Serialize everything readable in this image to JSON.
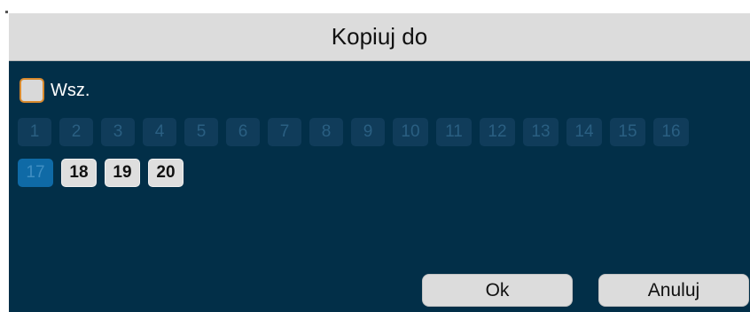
{
  "dialog": {
    "title": "Kopiuj do",
    "select_all_label": "Wsz.",
    "select_all_checked": false,
    "channels_row1": [
      {
        "label": "1",
        "state": "disabled"
      },
      {
        "label": "2",
        "state": "disabled"
      },
      {
        "label": "3",
        "state": "disabled"
      },
      {
        "label": "4",
        "state": "disabled"
      },
      {
        "label": "5",
        "state": "disabled"
      },
      {
        "label": "6",
        "state": "disabled"
      },
      {
        "label": "7",
        "state": "disabled"
      },
      {
        "label": "8",
        "state": "disabled"
      },
      {
        "label": "9",
        "state": "disabled"
      },
      {
        "label": "10",
        "state": "disabled"
      },
      {
        "label": "11",
        "state": "disabled"
      },
      {
        "label": "12",
        "state": "disabled"
      },
      {
        "label": "13",
        "state": "disabled"
      },
      {
        "label": "14",
        "state": "disabled"
      },
      {
        "label": "15",
        "state": "disabled"
      },
      {
        "label": "16",
        "state": "disabled"
      }
    ],
    "channels_row2": [
      {
        "label": "17",
        "state": "active"
      },
      {
        "label": "18",
        "state": "enabled"
      },
      {
        "label": "19",
        "state": "enabled"
      },
      {
        "label": "20",
        "state": "enabled"
      }
    ],
    "ok_label": "Ok",
    "cancel_label": "Anuluj"
  },
  "colors": {
    "dialog_bg": "#022f48",
    "titlebar_bg": "#dcdcdc",
    "checkbox_border": "#d88a2e",
    "channel_disabled": "#103c5a",
    "channel_active": "#0f6aa6",
    "channel_enabled": "#dedede"
  }
}
